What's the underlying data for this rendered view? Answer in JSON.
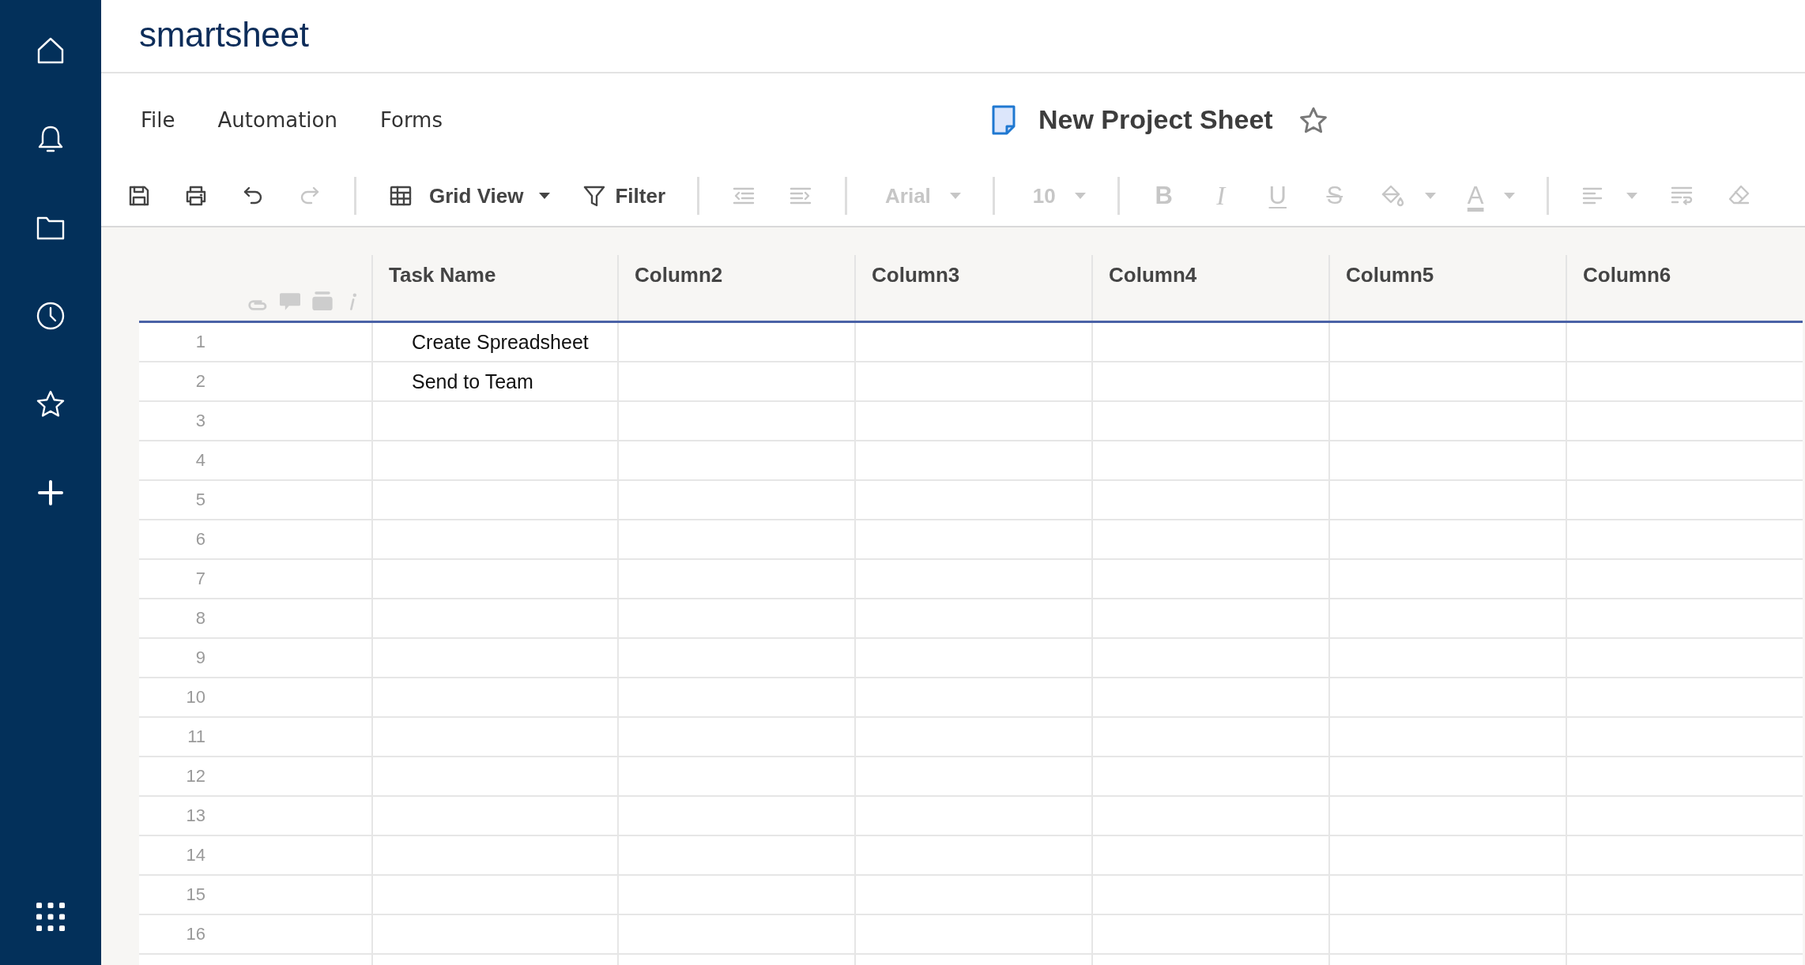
{
  "header": {
    "logo": "smartsheet"
  },
  "menu": [
    "File",
    "Automation",
    "Forms"
  ],
  "sheet": {
    "title": "New Project Sheet",
    "favorite": false
  },
  "toolbar": {
    "save": {
      "disabled": false
    },
    "print": {
      "disabled": false
    },
    "undo": {
      "disabled": false
    },
    "redo": {
      "disabled": true
    },
    "view": {
      "label": "Grid View",
      "disabled": false
    },
    "filter": {
      "label": "Filter",
      "disabled": false
    },
    "outdent": {
      "disabled": true
    },
    "indent": {
      "disabled": true
    },
    "font": {
      "value": "Arial",
      "disabled": true
    },
    "font_size": {
      "value": "10",
      "disabled": true
    },
    "bold": {
      "label": "B",
      "disabled": true
    },
    "italic": {
      "label": "I",
      "disabled": true
    },
    "underline": {
      "label": "U",
      "disabled": true
    },
    "strikethrough": {
      "label": "S",
      "disabled": true
    },
    "fill_color": {
      "disabled": true
    },
    "text_color": {
      "label": "A",
      "disabled": true
    },
    "align": {
      "disabled": true
    },
    "wrap": {
      "disabled": true
    },
    "clear_format": {
      "disabled": true
    }
  },
  "grid": {
    "columns": [
      "Task Name",
      "Column2",
      "Column3",
      "Column4",
      "Column5",
      "Column6"
    ],
    "rows": [
      {
        "number": "1",
        "cells": [
          "Create Spreadsheet"
        ]
      },
      {
        "number": "2",
        "cells": [
          "Send to Team"
        ]
      },
      {
        "number": "3"
      },
      {
        "number": "4"
      },
      {
        "number": "5"
      },
      {
        "number": "6"
      },
      {
        "number": "7"
      },
      {
        "number": "8"
      },
      {
        "number": "9"
      },
      {
        "number": "10"
      },
      {
        "number": "11"
      },
      {
        "number": "12"
      },
      {
        "number": "13"
      },
      {
        "number": "14"
      },
      {
        "number": "15"
      },
      {
        "number": "16"
      }
    ]
  }
}
